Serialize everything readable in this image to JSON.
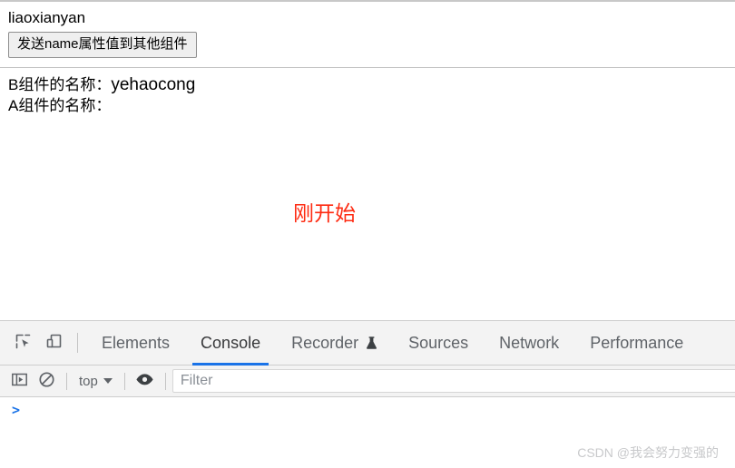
{
  "page": {
    "title": "liaoxianyan",
    "send_button_label": "发送name属性值到其他组件",
    "component_b_label": "B组件的名称：",
    "component_b_value": "yehaocong",
    "component_a_label": "A组件的名称：",
    "highlight_text": "刚开始",
    "highlight_color": "#fe2b12"
  },
  "devtools": {
    "icons": {
      "inspect": "inspect-element-icon",
      "device": "device-toolbar-icon",
      "sidebar": "console-sidebar-icon",
      "clear": "clear-console-icon",
      "eye": "live-expression-eye-icon",
      "flask": "experiment-flask-icon"
    },
    "tabs": [
      {
        "label": "Elements",
        "active": false,
        "flask": false
      },
      {
        "label": "Console",
        "active": true,
        "flask": false
      },
      {
        "label": "Recorder",
        "active": false,
        "flask": true
      },
      {
        "label": "Sources",
        "active": false,
        "flask": false
      },
      {
        "label": "Network",
        "active": false,
        "flask": false
      },
      {
        "label": "Performance",
        "active": false,
        "flask": false
      }
    ],
    "active_tab_accent": "#1a73e8",
    "console_toolbar": {
      "context_value": "top",
      "filter_placeholder": "Filter",
      "filter_value": ""
    },
    "console": {
      "prompt_symbol": ">",
      "input_value": ""
    }
  },
  "watermark": {
    "text": "CSDN @我会努力变强的"
  }
}
